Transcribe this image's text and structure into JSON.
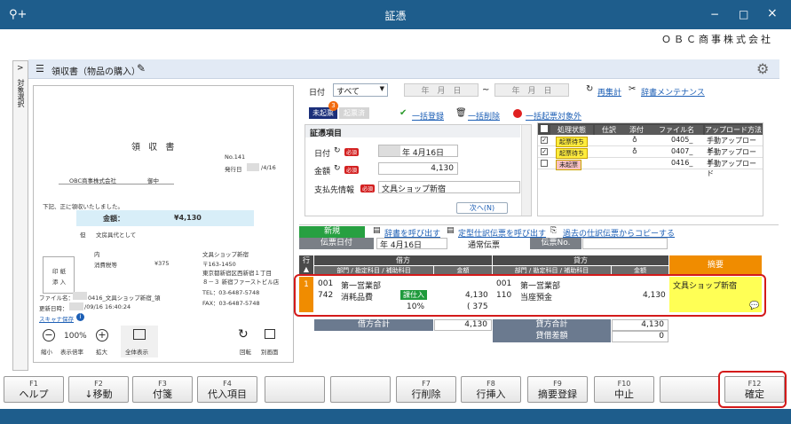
{
  "window": {
    "title": "証憑",
    "brand_icon": "search-plus-icon",
    "minimize": "−",
    "maximize": "□",
    "close": "×"
  },
  "company": "ＯＢＣ商事株式会社",
  "left_strip": {
    "label": "対象選択",
    "arrow": ">"
  },
  "doc": {
    "title": "領収書（物品の購入）"
  },
  "receipt": {
    "title": "領 収 書",
    "no": "No.141",
    "issue_label": "発行日",
    "issue_date": "/4/16",
    "to": "OBC商事株式会社",
    "to_suffix": "御中",
    "note": "下記、正に領収いたしました。",
    "amount_label": "金額：",
    "amount": "¥4,130",
    "proviso_label": "但",
    "proviso": "文房具代として",
    "detail_label": "内",
    "tax_label": "消費税等",
    "tax_value": "¥375",
    "stamp_1": "印 紙",
    "stamp_2": "添 入",
    "shop_name": "文具ショップ新宿",
    "shop_zip": "〒163-1450",
    "shop_addr1": "東京都新宿区西新宿１丁目",
    "shop_addr2": "８－３ 新宿ファーストビル店",
    "shop_tel": "TEL：03-6487-5748",
    "shop_fax": "FAX：03-6487-5748"
  },
  "file_info": {
    "file_label": "ファイル名：",
    "file_name": "0416_文具ショップ新宿_領",
    "updated_label": "更新日時：",
    "updated": "/09/16 16:40:24",
    "scanner": "スキャナ保存",
    "info_icon": "info-icon"
  },
  "viewer": {
    "zoom_out": "縮小",
    "zoom_value": "100%",
    "zoom_value_label": "表示倍率",
    "zoom_in": "拡大",
    "fit": "全体表示",
    "rotate": "回転",
    "separate": "別画面"
  },
  "filter": {
    "date_label": "日付",
    "date_option": "すべて",
    "date_from": "年　月　日",
    "tilde": "~",
    "date_to": "年　月　日",
    "refresh": "再集計",
    "maintenance": "辞書メンテナンス"
  },
  "tabs": {
    "unissued": "未起票",
    "unissued_count": "3",
    "issued": "起票済"
  },
  "actions": {
    "bulk_register": "一括登録",
    "bulk_delete": "一括削除",
    "bulk_exclude": "一括起票対象外"
  },
  "evidence": {
    "header": "証憑項目",
    "date_label": "日付",
    "date_value": "年 4月16日",
    "amount_label": "金額",
    "amount_value": "4,130",
    "payee_label": "支払先情報",
    "payee_value": "文具ショップ新宿",
    "next": "次へ(N)",
    "required": "必須"
  },
  "list": {
    "headers": [
      "処理状態",
      "仕訳",
      "添付",
      "ファイル名",
      "アップロード方法"
    ],
    "rows": [
      {
        "checked": true,
        "status": "起票待ち",
        "attach": true,
        "file": "0405_",
        "method": "手動アップロード"
      },
      {
        "checked": true,
        "status": "起票待ち",
        "attach": true,
        "file": "0407_",
        "method": "手動アップロード"
      },
      {
        "checked": false,
        "status": "未起票",
        "attach": false,
        "file": "0416_",
        "method": "手動アップロード"
      }
    ]
  },
  "voucher": {
    "new_label": "新規",
    "call_dict": "辞書を呼び出す",
    "call_template": "定型仕訳伝票を呼び出す",
    "copy_past": "過去の仕訳伝票からコピーする",
    "date_label": "伝票日付",
    "date_value": "年 4月16日",
    "type": "通常伝票",
    "no_label": "伝票No."
  },
  "journal": {
    "row_header": "行",
    "debit_header": "借方",
    "credit_header": "貸方",
    "summary_header": "摘要",
    "sub_header": "部門 / 勘定科目 / 補助科目",
    "amount_header": "金額",
    "row": {
      "no": "1",
      "debit_dept_code": "001",
      "debit_dept": "第一営業部",
      "debit_acct_code": "742",
      "debit_acct": "消耗品費",
      "tax_badge": "課仕入",
      "debit_amount": "4,130",
      "tax_rate": "10%",
      "tax_amount": "( 375",
      "credit_dept_code": "001",
      "credit_dept": "第一営業部",
      "credit_acct_code": "110",
      "credit_acct": "当座預金",
      "credit_amount": "4,130",
      "summary": "文具ショップ新宿"
    },
    "debit_total_label": "借方合計",
    "debit_total": "4,130",
    "credit_total_label": "貸方合計",
    "credit_total": "4,130",
    "diff_label": "貸借差額",
    "diff": "0"
  },
  "fkeys": [
    {
      "k": "F1",
      "l": "ヘルプ"
    },
    {
      "k": "F2",
      "l": "↓移動"
    },
    {
      "k": "F3",
      "l": "付箋"
    },
    {
      "k": "F4",
      "l": "代入項目"
    },
    {
      "k": "",
      "l": ""
    },
    {
      "k": "",
      "l": ""
    },
    {
      "k": "F7",
      "l": "行削除"
    },
    {
      "k": "F8",
      "l": "行挿入"
    },
    {
      "k": "F9",
      "l": "摘要登録"
    },
    {
      "k": "F10",
      "l": "中止"
    },
    {
      "k": "",
      "l": ""
    },
    {
      "k": "F12",
      "l": "確定"
    }
  ],
  "colors": {
    "titlebar": "#1e5d8c",
    "highlight": "#d41a1a",
    "summary_yellow": "#ffff55",
    "summary_header": "#f08c00",
    "status_wait": "#ffec3d",
    "status_un": "#f9c2c2"
  }
}
